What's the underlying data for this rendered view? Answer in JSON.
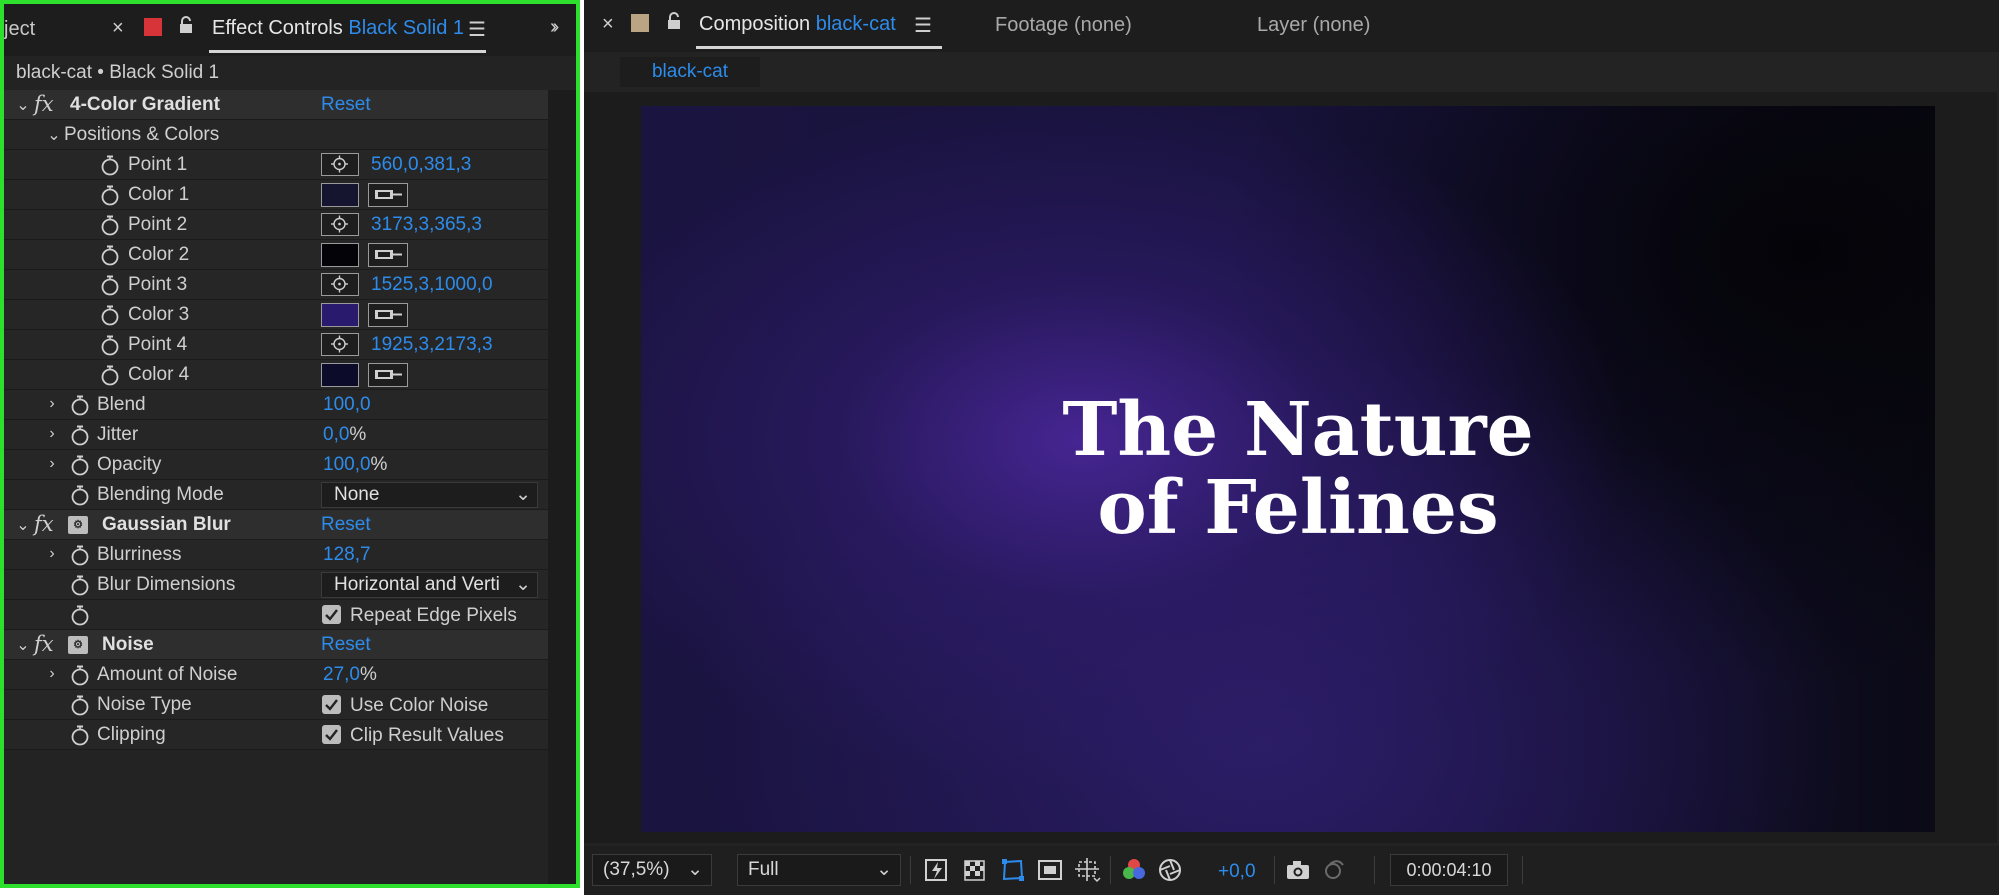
{
  "left_panel": {
    "tabs": {
      "project_partial": "ject",
      "effect_controls_label": "Effect Controls",
      "effect_controls_target": "Black Solid 1"
    },
    "breadcrumb": "black-cat • Black Solid 1",
    "effects": {
      "four_color_gradient": {
        "name": "4-Color Gradient",
        "reset": "Reset",
        "positions_colors": "Positions & Colors",
        "point1_label": "Point 1",
        "point1_value": "560,0,381,3",
        "color1_label": "Color 1",
        "color1_hex": "#151530",
        "point2_label": "Point 2",
        "point2_value": "3173,3,365,3",
        "color2_label": "Color 2",
        "color2_hex": "#040408",
        "point3_label": "Point 3",
        "point3_value": "1525,3,1000,0",
        "color3_label": "Color 3",
        "color3_hex": "#2a1a6e",
        "point4_label": "Point 4",
        "point4_value": "1925,3,2173,3",
        "color4_label": "Color 4",
        "color4_hex": "#0c0b2a",
        "blend_label": "Blend",
        "blend_value": "100,0",
        "jitter_label": "Jitter",
        "jitter_value": "0,0",
        "jitter_unit": "%",
        "opacity_label": "Opacity",
        "opacity_value": "100,0",
        "opacity_unit": "%",
        "blending_mode_label": "Blending Mode",
        "blending_mode_value": "None"
      },
      "gaussian_blur": {
        "name": "Gaussian Blur",
        "reset": "Reset",
        "blurriness_label": "Blurriness",
        "blurriness_value": "128,7",
        "blur_dimensions_label": "Blur Dimensions",
        "blur_dimensions_value": "Horizontal and Verti",
        "repeat_edge_label": "Repeat Edge Pixels"
      },
      "noise": {
        "name": "Noise",
        "reset": "Reset",
        "amount_label": "Amount of Noise",
        "amount_value": "27,0",
        "amount_unit": "%",
        "noise_type_label": "Noise Type",
        "use_color_noise_label": "Use Color Noise",
        "clipping_label": "Clipping",
        "clip_result_label": "Clip Result Values"
      }
    }
  },
  "right_panel": {
    "composition_label": "Composition",
    "composition_name": "black-cat",
    "footage_tab": "Footage (none)",
    "layer_tab": "Layer (none)",
    "comp_chip": "black-cat",
    "canvas_title_line1": "The Nature",
    "canvas_title_line2": "of Felines",
    "toolbar": {
      "zoom": "(37,5%)",
      "resolution": "Full",
      "exposure": "+0,0",
      "timecode": "0:00:04:10"
    }
  },
  "colors": {
    "accent_blue": "#2d8ceb",
    "highlight_green": "#2ee02e",
    "panel_bg": "#232323",
    "label_red": "#d7343a",
    "label_tan": "#b9a483"
  }
}
